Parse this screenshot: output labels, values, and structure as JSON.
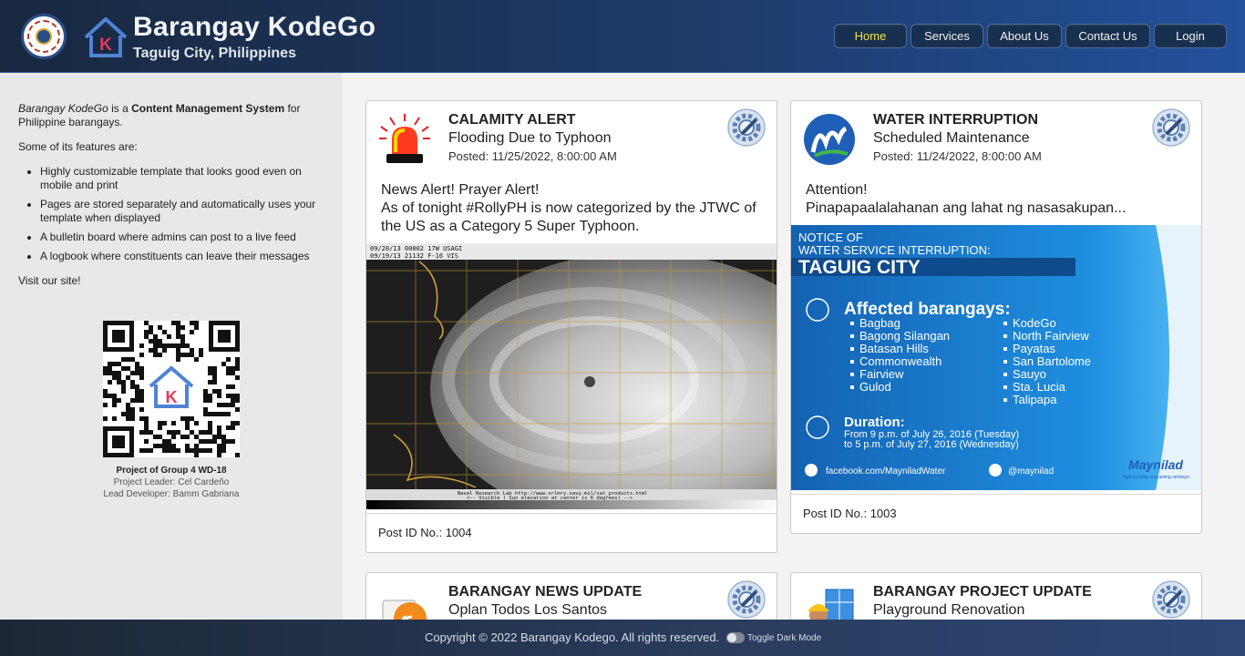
{
  "header": {
    "title": "Barangay KodeGo",
    "subtitle": "Taguig City, Philippines",
    "seal_icon": "city-seal-icon",
    "logo_icon": "house-k-logo-icon",
    "logo_letter": "K",
    "nav": [
      {
        "label": "Home",
        "active": true
      },
      {
        "label": "Services"
      },
      {
        "label": "About Us"
      },
      {
        "label": "Contact Us"
      },
      {
        "label": "Login"
      }
    ],
    "active_color": "#f6e14b"
  },
  "sidebar": {
    "intro_name": "Barangay KodeGo",
    "intro_mid": " is a ",
    "intro_bold": "Content Management System",
    "intro_end": " for Philippine barangays.",
    "features_lead": "Some of its features are:",
    "features": [
      "Highly customizable template that looks good even on mobile and print",
      "Pages are stored separately and automatically uses your template when displayed",
      "A bulletin board where admins can post to a live feed",
      "A logbook where constituents can leave their messages"
    ],
    "visit": "Visit our site!",
    "qr_icon": "qr-code-icon",
    "project": "Project of Group 4 WD-18",
    "leader": "Project Leader: Cel Cardeño",
    "developer": "Lead Developer: Bamm Gabriana"
  },
  "posts": [
    {
      "title": "CALAMITY ALERT",
      "subtitle": "Flooding Due to Typhoon",
      "date": "Posted: 11/25/2022, 8:00:00 AM",
      "icon": "siren-icon",
      "body1": "News Alert! Prayer Alert!",
      "body2": "As of tonight #RollyPH is now categorized by the JTWC of the US as a Category 5 Super Typhoon.",
      "image_header": "09/20/13  00002   17W USAGI",
      "image_header2": "09/19/13  21132   F-16 VIS",
      "image_footer": "Naval Research Lab http://www.nrlmry.navy.mil/sat_products.html",
      "image_footer2": "<--  Visible ( Sun elevation at center is 6 degrees)  -->",
      "footer": "Post ID No.: 1004"
    },
    {
      "title": "WATER INTERRUPTION",
      "subtitle": "Scheduled Maintenance",
      "date": "Posted: 11/24/2022, 8:00:00 AM",
      "icon": "maynilad-logo-icon",
      "body1": "Attention!",
      "body2": "Pinapapaalalahanan ang lahat ng nasasakupan...",
      "notice": {
        "line1": "NOTICE OF",
        "line2": "WATER SERVICE INTERRUPTION:",
        "city": "TAGUIG CITY",
        "affected": "Affected barangays:",
        "left": [
          "Bagbag",
          "Bagong Silangan",
          "Batasan Hills",
          "Commonwealth",
          "Fairview",
          "Gulod"
        ],
        "right": [
          "KodeGo",
          "North Fairview",
          "Payatas",
          "San Bartolome",
          "Sauyo",
          "Sta. Lucia",
          "Talipapa"
        ],
        "duration": "Duration:",
        "from": "From 9 p.m. of July 26, 2016 (Tuesday)",
        "to": "to 5 p.m. of July 27, 2016 (Wednesday)",
        "facebook": "facebook.com/MayniladWater",
        "twitter": "@maynilad",
        "brand": "Maynilad",
        "tagline": "Higit sa tubig ang aming serbisyo"
      },
      "footer": "Post ID No.: 1003"
    },
    {
      "title": "BARANGAY NEWS UPDATE",
      "subtitle": "Oplan Todos Los Santos",
      "icon": "newspaper-rss-icon"
    },
    {
      "title": "BARANGAY PROJECT UPDATE",
      "subtitle": "Playground Renovation",
      "icon": "construction-worker-icon"
    }
  ],
  "gear_icon": "settings-gear-icon",
  "footer": {
    "copyright": "Copyright © 2022 Barangay Kodego. All rights reserved.",
    "toggle_label": "Toggle Dark Mode"
  }
}
